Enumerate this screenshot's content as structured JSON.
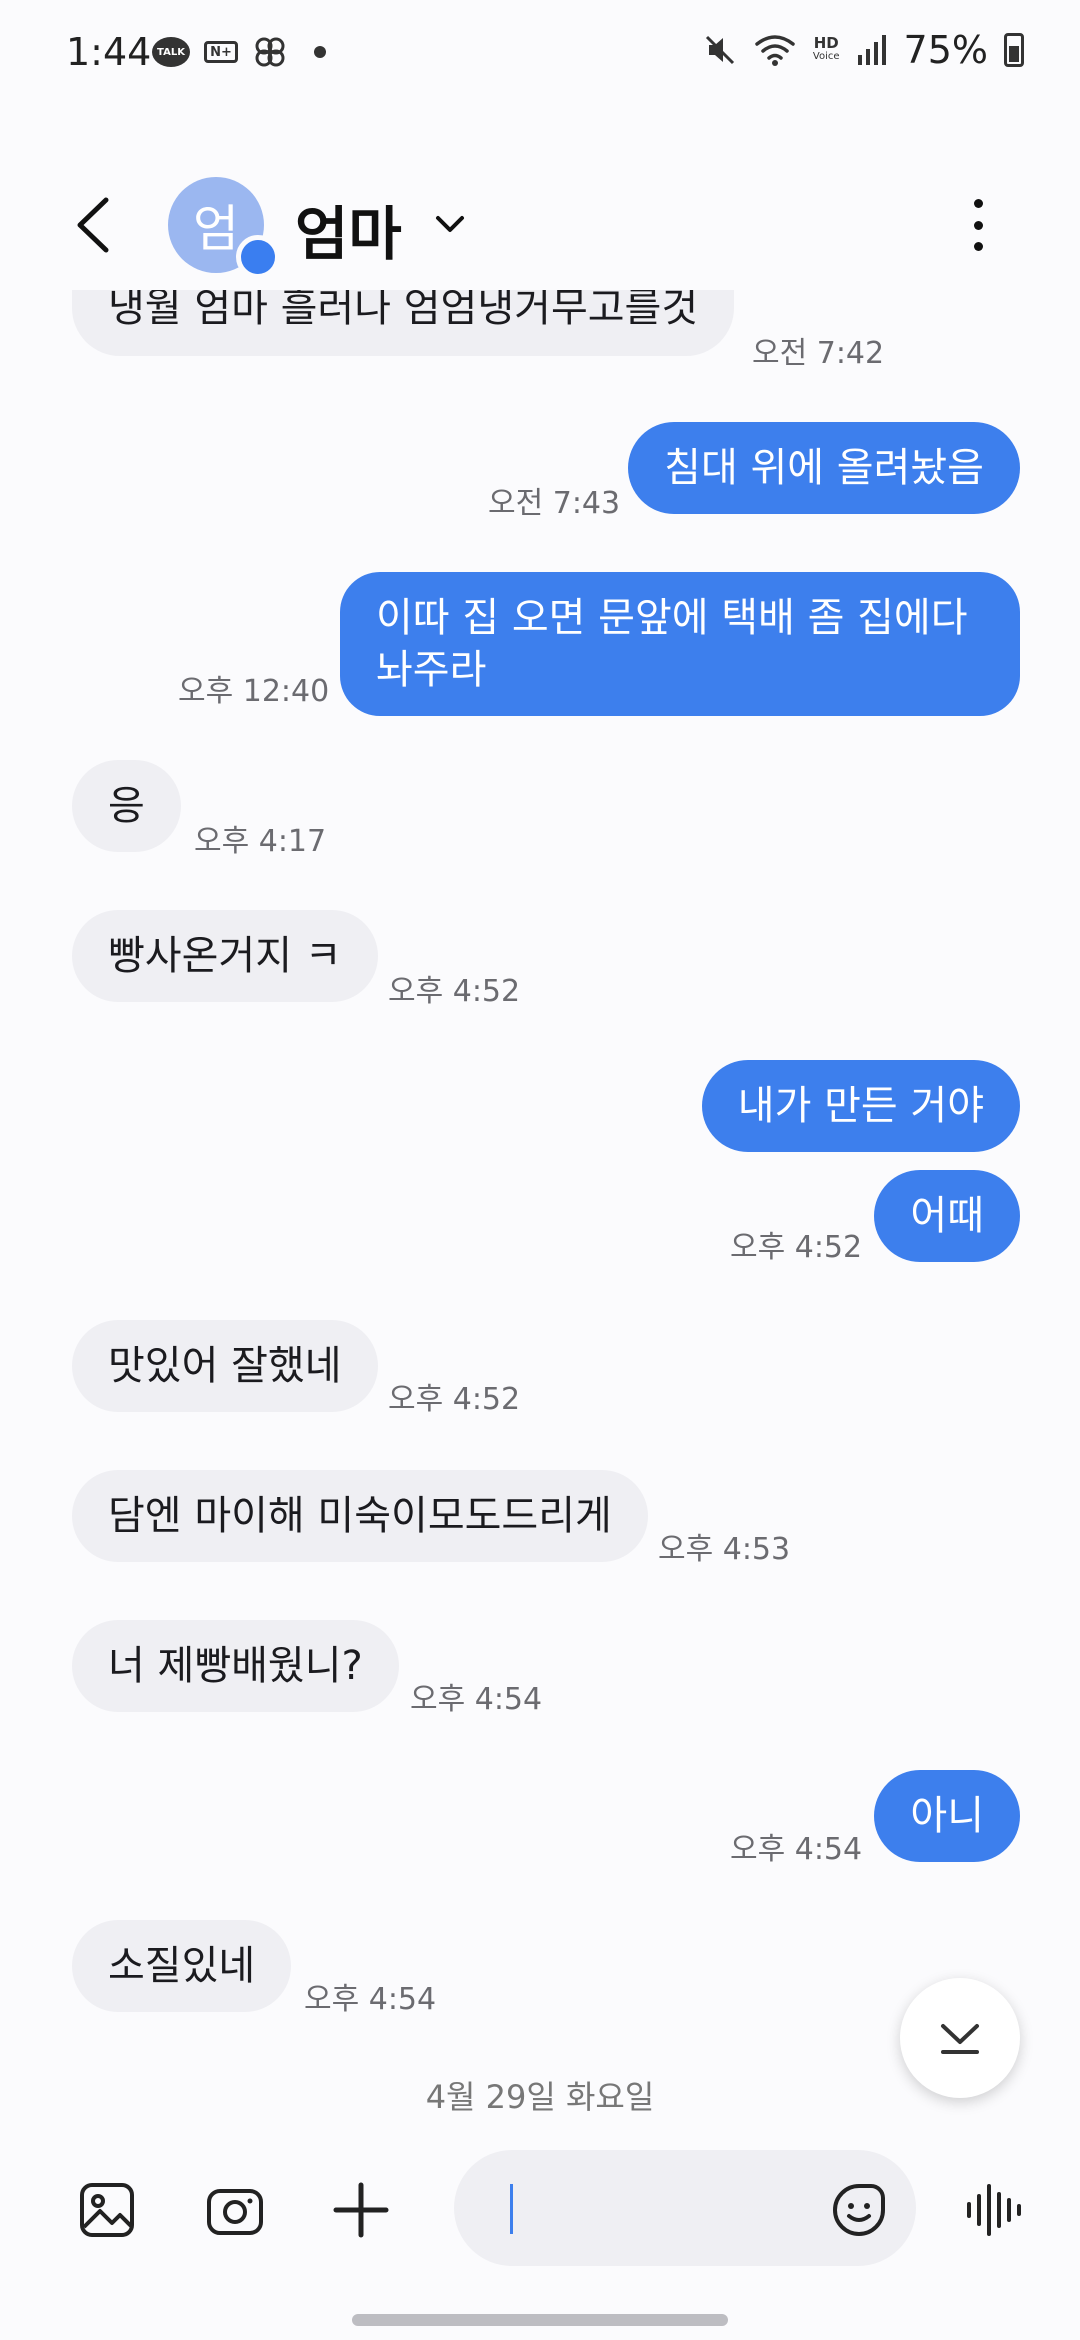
{
  "status_bar": {
    "time": "1:44",
    "battery": "75%",
    "icons": [
      "talk-icon",
      "naver-plus-icon",
      "pinwheel-icon",
      "notification-dot-icon",
      "mute-icon",
      "wifi-icon",
      "hd-voice-icon",
      "signal-icon",
      "battery-icon"
    ],
    "talk_label": "TALK",
    "nplus_label": "N+",
    "hd_label": "HD",
    "voice_label": "Voice"
  },
  "header": {
    "avatar_initial": "엄",
    "contact_name": "엄마"
  },
  "messages": [
    {
      "id": "m0",
      "direction": "in",
      "text": "냉월 엄마 흘러나 엄엄냉거무고를것",
      "time": "오전 7:42"
    },
    {
      "id": "m1",
      "direction": "out",
      "text": "침대 위에 올려놨음",
      "time": "오전 7:43"
    },
    {
      "id": "m2",
      "direction": "out",
      "lines": [
        "이따 집 오면 문앞에 택배 좀 집에다",
        "놔주라"
      ],
      "time": "오후 12:40"
    },
    {
      "id": "m3",
      "direction": "in",
      "text": "응",
      "time": "오후 4:17"
    },
    {
      "id": "m4",
      "direction": "in",
      "text": "빵사온거지 ㅋ",
      "time": "오후 4:52"
    },
    {
      "id": "m5",
      "direction": "out",
      "text": "내가 만든 거야",
      "time": ""
    },
    {
      "id": "m6",
      "direction": "out",
      "text": "어때",
      "time": "오후 4:52"
    },
    {
      "id": "m7",
      "direction": "in",
      "text": "맛있어 잘했네",
      "time": "오후 4:52"
    },
    {
      "id": "m8",
      "direction": "in",
      "text": "담엔 마이해 미숙이모도드리게",
      "time": "오후 4:53"
    },
    {
      "id": "m9",
      "direction": "in",
      "text": "너 제빵배웠니?",
      "time": "오후 4:54"
    },
    {
      "id": "m10",
      "direction": "out",
      "text": "아니",
      "time": "오후 4:54"
    },
    {
      "id": "m11",
      "direction": "in",
      "text": "소질있네",
      "time": "오후 4:54"
    }
  ],
  "date_separator": "4월 29일 화요일",
  "composer": {
    "input_value": "",
    "icons": [
      "gallery-icon",
      "camera-icon",
      "plus-icon",
      "emoji-sticker-icon",
      "voice-wave-icon"
    ]
  },
  "colors": {
    "outgoing_bubble": "#3d7fed",
    "incoming_bubble": "#efeff3",
    "background": "#fbfbfd",
    "avatar": "#9bb7f0"
  }
}
